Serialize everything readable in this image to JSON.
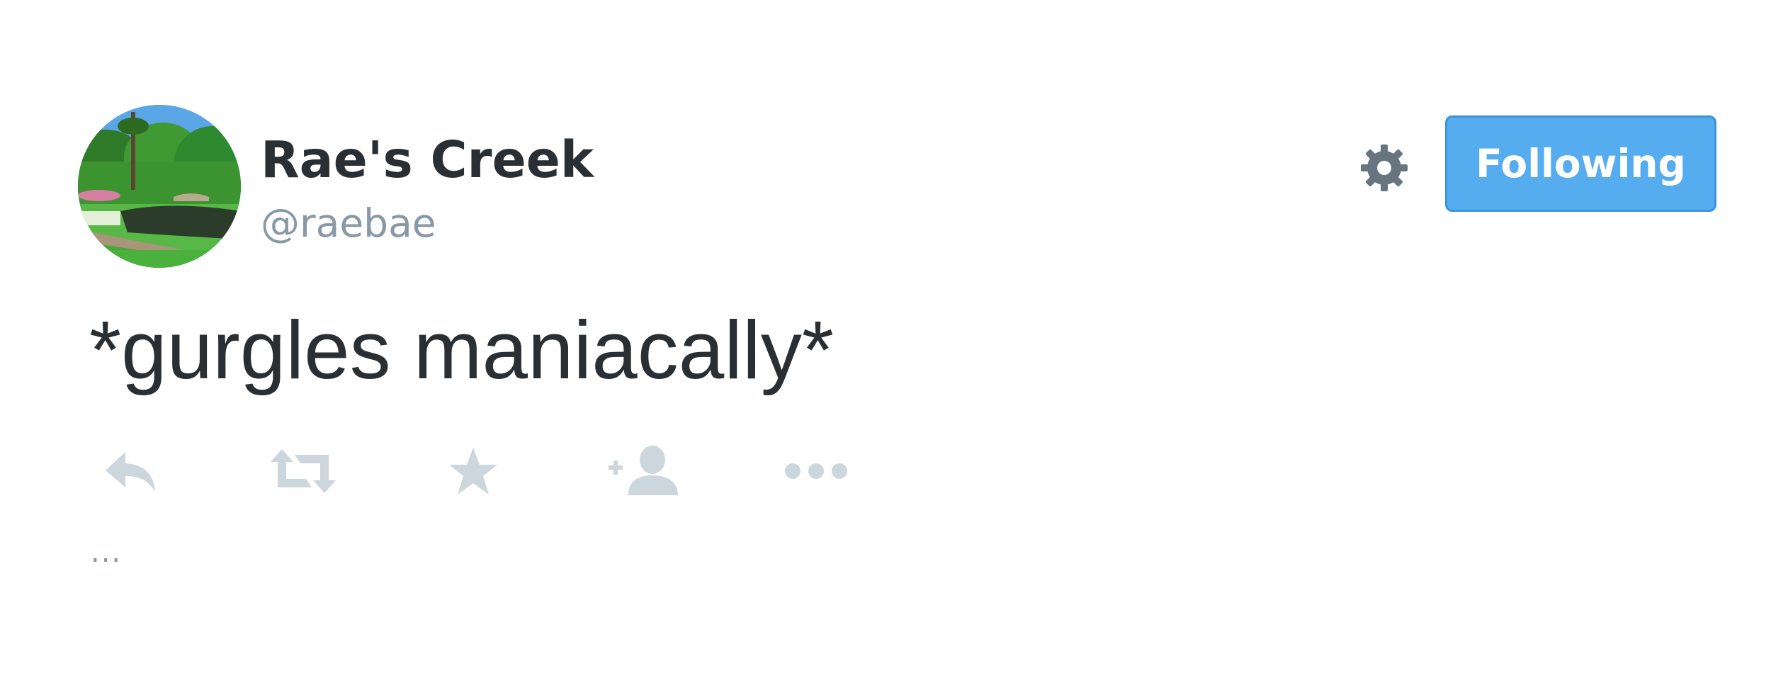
{
  "tweet": {
    "author": {
      "display_name": "Rae's Creek",
      "handle": "@raebae",
      "avatar_icon": "golf-course-photo"
    },
    "follow_button_label": "Following",
    "settings_icon": "gear-icon",
    "text": "*gurgles maniacally*",
    "actions": [
      {
        "name": "reply",
        "icon": "reply-icon"
      },
      {
        "name": "retweet",
        "icon": "retweet-icon"
      },
      {
        "name": "favorite",
        "icon": "star-icon"
      },
      {
        "name": "follow",
        "icon": "add-user-icon"
      },
      {
        "name": "more",
        "icon": "more-dots-icon"
      }
    ],
    "footer_ellipsis": "..."
  },
  "colors": {
    "text": "#292f33",
    "secondary": "#8899a6",
    "action_icon": "#ccd6dd",
    "button_blue": "#55acee",
    "gear": "#66757f"
  }
}
